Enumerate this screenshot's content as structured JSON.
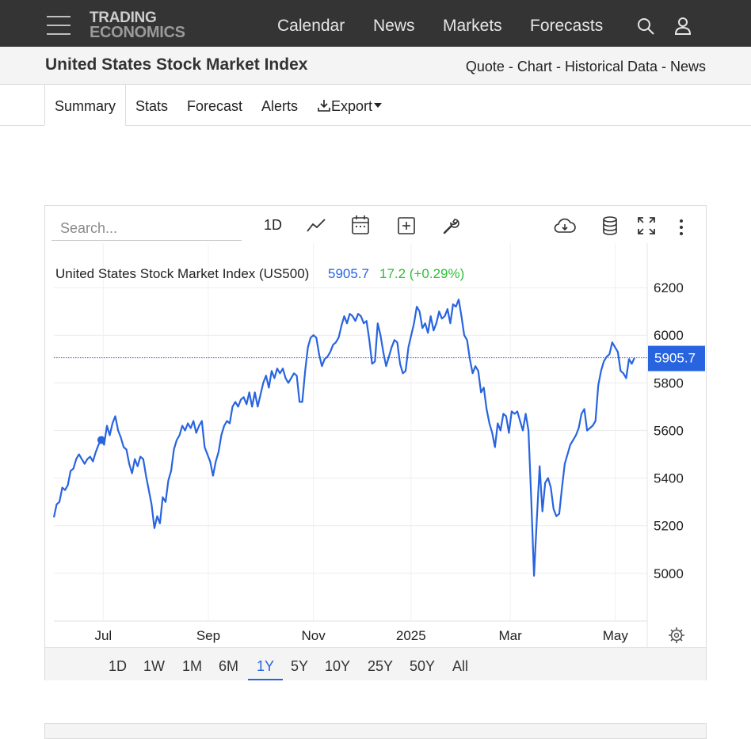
{
  "nav": {
    "logo_line1": "TRADING",
    "logo_line2": "ECONOMICS",
    "links": [
      "Calendar",
      "News",
      "Markets",
      "Forecasts"
    ]
  },
  "header": {
    "title": "United States Stock Market Index",
    "links": [
      "Quote",
      "Chart",
      "Historical Data",
      "News"
    ],
    "separator": " - "
  },
  "tabs": [
    "Summary",
    "Stats",
    "Forecast",
    "Alerts",
    "Export"
  ],
  "active_tab": "Summary",
  "toolbar": {
    "search_placeholder": "Search...",
    "interval": "1D"
  },
  "ranges": [
    "1D",
    "1W",
    "1M",
    "6M",
    "1Y",
    "5Y",
    "10Y",
    "25Y",
    "50Y",
    "All"
  ],
  "active_range": "1Y",
  "colors": {
    "nav_bg": "#343434",
    "line": "#2864e0",
    "change_positive": "#2fbf3a",
    "price_badge": "#2864e0"
  },
  "chart_data": {
    "type": "line",
    "legend_name": "United States Stock Market Index (US500)",
    "last_value": "5905.7",
    "change": "17.2 (+0.29%)",
    "price_label": "5905.7",
    "ylim": [
      4800,
      6380
    ],
    "yticks": [
      6200,
      6000,
      5800,
      5600,
      5400,
      5200,
      5000
    ],
    "xticks": [
      "Jul",
      "Sep",
      "Nov",
      "2025",
      "Mar",
      "May"
    ],
    "grid": true,
    "series": [
      {
        "values": [
          5235,
          5290,
          5300,
          5360,
          5350,
          5370,
          5430,
          5440,
          5480,
          5500,
          5480,
          5460,
          5480,
          5490,
          5470,
          5510,
          5540,
          5560,
          5540,
          5620,
          5580,
          5630,
          5660,
          5600,
          5570,
          5530,
          5520,
          5460,
          5420,
          5480,
          5450,
          5490,
          5480,
          5410,
          5350,
          5290,
          5190,
          5240,
          5210,
          5320,
          5300,
          5390,
          5430,
          5520,
          5560,
          5580,
          5620,
          5600,
          5630,
          5610,
          5640,
          5590,
          5620,
          5640,
          5530,
          5500,
          5470,
          5410,
          5470,
          5510,
          5580,
          5620,
          5640,
          5630,
          5700,
          5720,
          5700,
          5730,
          5740,
          5710,
          5760,
          5700,
          5760,
          5700,
          5750,
          5800,
          5830,
          5780,
          5850,
          5820,
          5860,
          5840,
          5860,
          5820,
          5800,
          5820,
          5840,
          5830,
          5720,
          5720,
          5850,
          5950,
          5990,
          6000,
          5990,
          5920,
          5870,
          5900,
          5910,
          5930,
          5960,
          5970,
          5990,
          6040,
          6080,
          6050,
          6090,
          6080,
          6060,
          6090,
          6080,
          6050,
          6060,
          5980,
          5880,
          5890,
          6050,
          6000,
          5930,
          5870,
          5910,
          5950,
          5980,
          5970,
          5880,
          5840,
          5850,
          5950,
          6000,
          6050,
          6120,
          6100,
          6030,
          6050,
          6010,
          6080,
          6020,
          6050,
          6100,
          6070,
          6080,
          6110,
          6050,
          6130,
          6120,
          6150,
          6080,
          6000,
          5980,
          5900,
          5840,
          5870,
          5850,
          5760,
          5780,
          5690,
          5630,
          5590,
          5530,
          5630,
          5600,
          5670,
          5660,
          5590,
          5680,
          5670,
          5680,
          5640,
          5600,
          5670,
          5600,
          5310,
          4990,
          5230,
          5450,
          5260,
          5380,
          5400,
          5360,
          5270,
          5240,
          5250,
          5360,
          5460,
          5500,
          5540,
          5560,
          5580,
          5610,
          5670,
          5690,
          5600,
          5610,
          5620,
          5640,
          5790,
          5850,
          5890,
          5910,
          5920,
          5970,
          5950,
          5930,
          5850,
          5840,
          5820,
          5900,
          5880,
          5905.7
        ]
      }
    ]
  }
}
